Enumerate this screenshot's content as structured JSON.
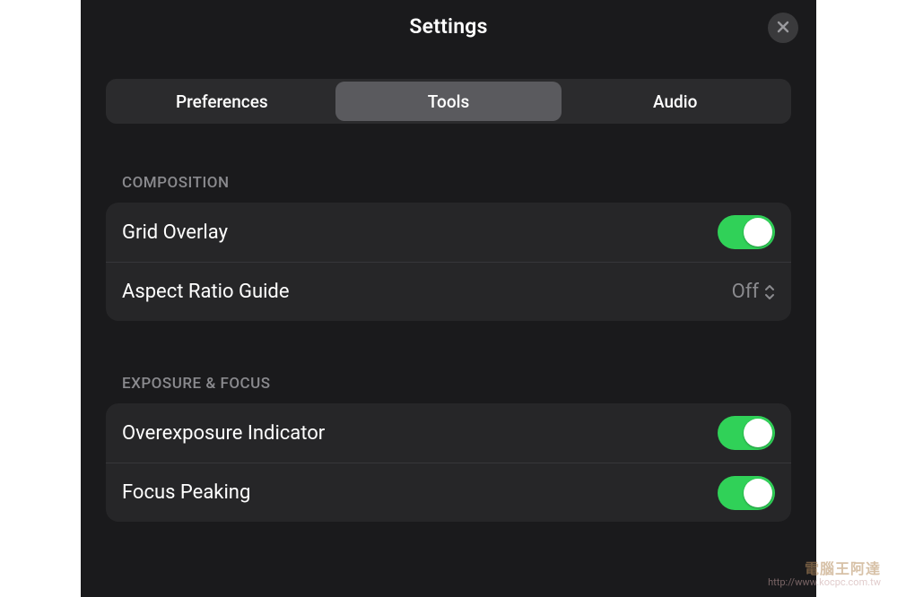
{
  "header": {
    "title": "Settings"
  },
  "tabs": {
    "items": [
      {
        "label": "Preferences"
      },
      {
        "label": "Tools"
      },
      {
        "label": "Audio"
      }
    ],
    "active_index": 1
  },
  "sections": {
    "composition": {
      "header": "COMPOSITION",
      "grid_overlay": {
        "label": "Grid Overlay",
        "on": true
      },
      "aspect_ratio": {
        "label": "Aspect Ratio Guide",
        "value": "Off"
      }
    },
    "exposure_focus": {
      "header": "EXPOSURE & FOCUS",
      "overexposure": {
        "label": "Overexposure Indicator",
        "on": true
      },
      "focus_peaking": {
        "label": "Focus Peaking",
        "on": true
      }
    }
  },
  "watermark": {
    "line1": "電腦王阿達",
    "line2": "http://www.kocpc.com.tw"
  }
}
